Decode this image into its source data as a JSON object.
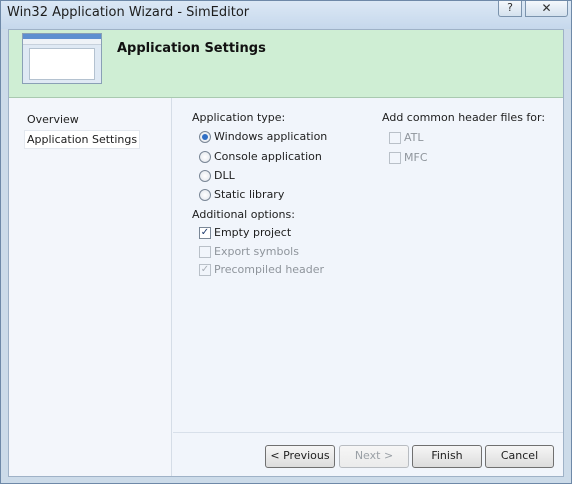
{
  "window": {
    "title": "Win32 Application Wizard - SimEditor",
    "help_label": "?",
    "close_label": "✕"
  },
  "banner": {
    "title": "Application Settings"
  },
  "nav": {
    "items": [
      {
        "label": "Overview",
        "selected": false
      },
      {
        "label": "Application Settings",
        "selected": true
      }
    ]
  },
  "app_type": {
    "label": "Application type:",
    "options": [
      {
        "label": "Windows application",
        "checked": true
      },
      {
        "label": "Console application",
        "checked": false
      },
      {
        "label": "DLL",
        "checked": false
      },
      {
        "label": "Static library",
        "checked": false
      }
    ]
  },
  "additional": {
    "label": "Additional options:",
    "options": [
      {
        "label": "Empty project",
        "checked": true,
        "enabled": true
      },
      {
        "label": "Export symbols",
        "checked": false,
        "enabled": false
      },
      {
        "label": "Precompiled header",
        "checked": true,
        "enabled": false
      }
    ]
  },
  "headers": {
    "label": "Add common header files for:",
    "options": [
      {
        "label": "ATL",
        "checked": false,
        "enabled": false
      },
      {
        "label": "MFC",
        "checked": false,
        "enabled": false
      }
    ]
  },
  "footer": {
    "previous_label": "< Previous",
    "next_label": "Next >",
    "finish_label": "Finish",
    "cancel_label": "Cancel"
  },
  "colors": {
    "banner_bg": "#cfeed4",
    "client_bg": "#f1f5fb",
    "radio_accent": "#2f6fc5"
  }
}
